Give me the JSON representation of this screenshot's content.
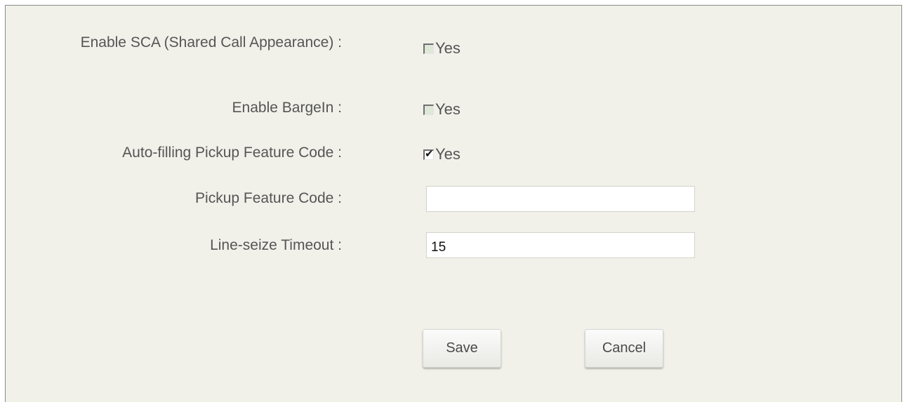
{
  "form": {
    "sca": {
      "label": "Enable SCA (Shared Call Appearance) :",
      "option": "Yes",
      "checked": false
    },
    "bargein": {
      "label": "Enable BargeIn :",
      "option": "Yes",
      "checked": false
    },
    "auto_pickup": {
      "label": "Auto-filling Pickup Feature Code :",
      "option": "Yes",
      "checked": true
    },
    "pickup_code": {
      "label": "Pickup Feature Code :",
      "value": ""
    },
    "line_seize": {
      "label": "Line-seize Timeout :",
      "value": "15"
    }
  },
  "buttons": {
    "save": "Save",
    "cancel": "Cancel"
  }
}
